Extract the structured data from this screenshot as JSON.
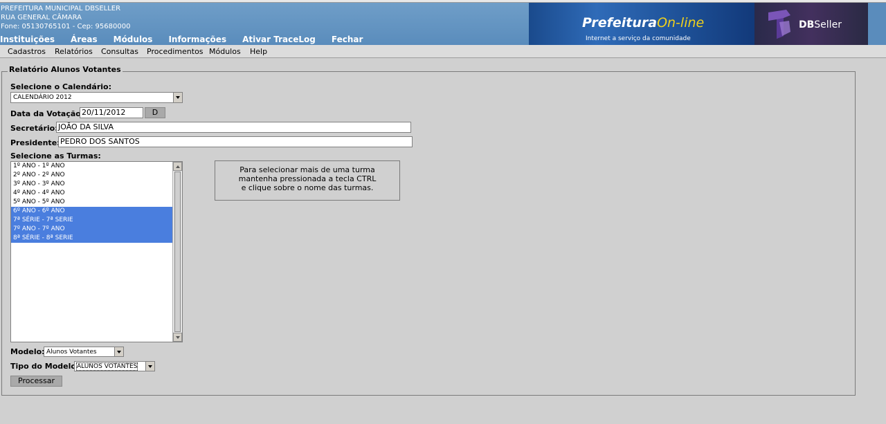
{
  "org": {
    "name": "PREFEITURA MUNICIPAL DBSELLER",
    "street": "RUA GENERAL CÂMARA",
    "contact": "Fone: 05130765101  -  Cep: 95680000"
  },
  "main_nav": [
    "Instituições",
    "Áreas",
    "Módulos",
    "Informações",
    "Ativar TraceLog",
    "Fechar"
  ],
  "brand": {
    "title_main": "Prefeitura",
    "title_online": "On-line",
    "subtitle": "Internet a serviço da comunidade",
    "dbseller_bold": "DB",
    "dbseller_light": "Seller"
  },
  "submenu": [
    "Cadastros",
    "Relatórios",
    "Consultas",
    "Procedimentos",
    "Módulos",
    "Help"
  ],
  "form": {
    "legend": "Relatório Alunos Votantes",
    "calendar_label": "Selecione o Calendário:",
    "calendar_value": "CALENDÁRIO 2012",
    "date_label": "Data da Votação:",
    "date_value": "20/11/2012",
    "date_button": "D",
    "secretary_label": "Secretário:",
    "secretary_value": "JOÃO DA SILVA",
    "president_label": "Presidente:",
    "president_value": "PEDRO DOS SANTOS",
    "classes_label": "Selecione as Turmas:",
    "classes": [
      {
        "label": "1º ANO - 1º ANO",
        "selected": false
      },
      {
        "label": "2º ANO - 2º ANO",
        "selected": false
      },
      {
        "label": "3º ANO - 3º ANO",
        "selected": false
      },
      {
        "label": "4º ANO - 4º ANO",
        "selected": false
      },
      {
        "label": "5º ANO - 5º ANO",
        "selected": false
      },
      {
        "label": "6º ANO - 6º ANO",
        "selected": true
      },
      {
        "label": "7ª SÉRIE - 7ª SERIE",
        "selected": true
      },
      {
        "label": "7º ANO - 7º ANO",
        "selected": true
      },
      {
        "label": "8ª SÉRIE - 8ª SERIE",
        "selected": true
      }
    ],
    "hint_lines": [
      "Para selecionar mais de uma turma",
      "mantenha pressionada a tecla CTRL",
      "e clique sobre o nome das turmas."
    ],
    "model_label": "Modelo:",
    "model_value": "Alunos Votantes",
    "model_type_label": "Tipo do Modelo:",
    "model_type_value": "ALUNOS VOTANTES",
    "process_button": "Processar"
  },
  "colors": {
    "header_bg": "#5a8cbc",
    "selection": "#4a7ede",
    "online_accent": "#f2d21b"
  }
}
